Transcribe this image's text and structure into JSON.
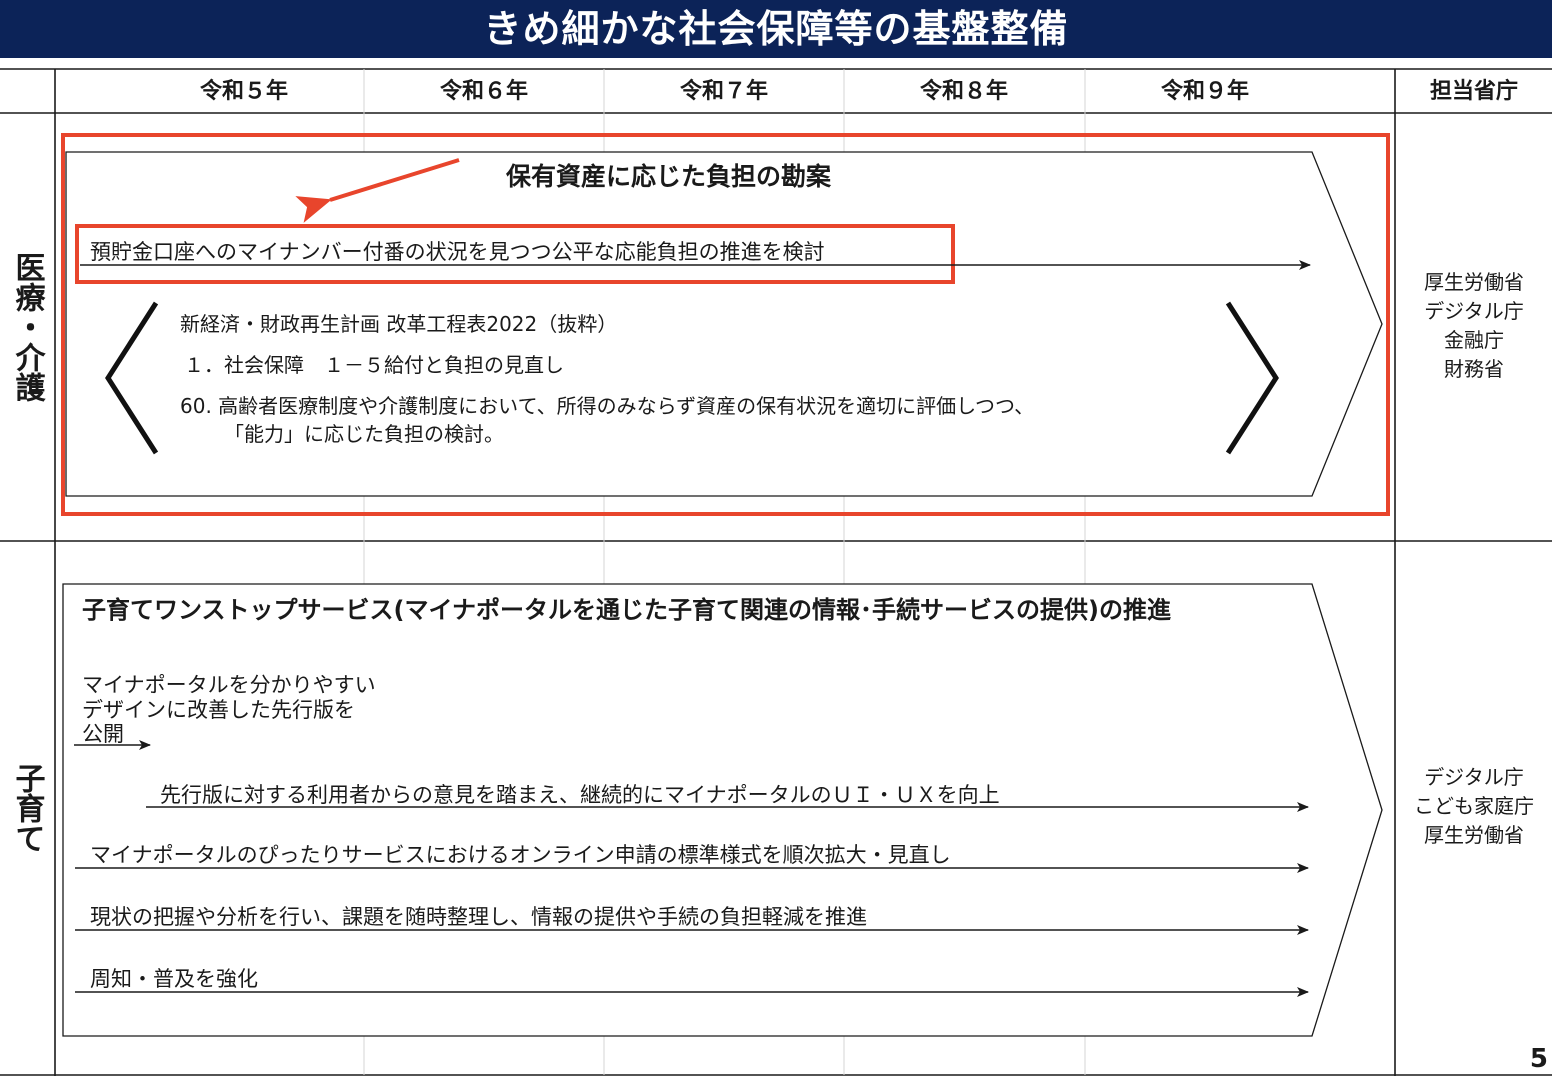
{
  "title": "きめ細かな社会保障等の基盤整備",
  "header": {
    "years": [
      "令和５年",
      "令和６年",
      "令和７年",
      "令和８年",
      "令和９年"
    ],
    "ministry_label": "担当省庁"
  },
  "section_medical": {
    "label": "医療・介護",
    "box_title": "保有資産に応じた負担の勘案",
    "highlight_item": "預貯金口座へのマイナンバー付番の状況を見つつ公平な応能負担の推進を検討",
    "quote_lines": [
      "新経済・財政再生計画 改革工程表2022（抜粋）",
      "１．社会保障　１－５給付と負担の見直し",
      "60.  高齢者医療制度や介護制度において、所得のみならず資産の保有状況を適切に評価しつつ、",
      "「能力」に応じた負担の検討。"
    ],
    "ministries": [
      "厚生労働省",
      "デジタル庁",
      "金融庁",
      "財務省"
    ]
  },
  "section_childcare": {
    "label": "子育て",
    "box_title": "子育てワンストップサービス(マイナポータルを通じた子育て関連の情報･手続サービスの提供)の推進",
    "first_item_lines": [
      "マイナポータルを分かりやすい",
      "デザインに改善した先行版を",
      "公開"
    ],
    "items": [
      "先行版に対する利用者からの意見を踏まえ、継続的にマイナポータルのＵＩ・ＵＸを向上",
      "マイナポータルのぴったりサービスにおけるオンライン申請の標準様式を順次拡大・見直し",
      "現状の把握や分析を行い、課題を随時整理し、情報の提供や手続の負担軽減を推進",
      "周知・普及を強化"
    ],
    "ministries": [
      "デジタル庁",
      "こども家庭庁",
      "厚生労働省"
    ]
  },
  "page_number": "5",
  "colors": {
    "title_bg": "#0c2358",
    "highlight": "#e8452c"
  }
}
